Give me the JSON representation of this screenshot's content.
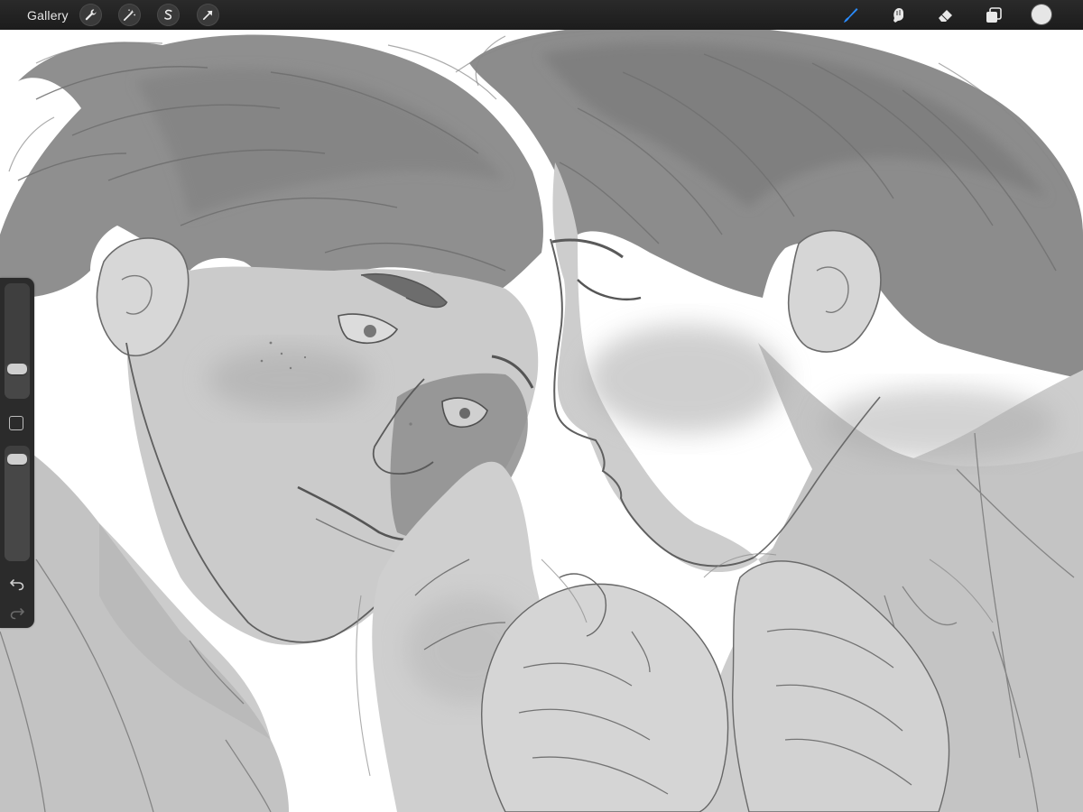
{
  "toolbar": {
    "gallery_label": "Gallery",
    "left_tools": [
      {
        "name": "actions",
        "icon": "wrench-icon"
      },
      {
        "name": "adjustments",
        "icon": "magic-wand-icon"
      },
      {
        "name": "selection",
        "icon": "selection-s-icon"
      },
      {
        "name": "transform",
        "icon": "arrow-cursor-icon"
      }
    ],
    "right_tools": [
      {
        "name": "brush",
        "icon": "brush-icon",
        "active": true
      },
      {
        "name": "smudge",
        "icon": "smudge-finger-icon",
        "active": false
      },
      {
        "name": "eraser",
        "icon": "eraser-icon",
        "active": false
      },
      {
        "name": "layers",
        "icon": "layers-icon",
        "active": false
      }
    ],
    "color": "#e6e6e6",
    "accent_color": "#2a8cff"
  },
  "sidebar": {
    "brush_size": 0.22,
    "brush_opacity": 0.95,
    "icons": [
      "modify-square-icon",
      "undo-icon",
      "redo-icon"
    ]
  },
  "canvas": {
    "description_free": true,
    "background": "#ffffff",
    "ink": "#6e6e6e",
    "tone_light": "#c9c9c9",
    "tone_mid": "#a9a9a9",
    "tone_dark": "#8c8c8c"
  }
}
